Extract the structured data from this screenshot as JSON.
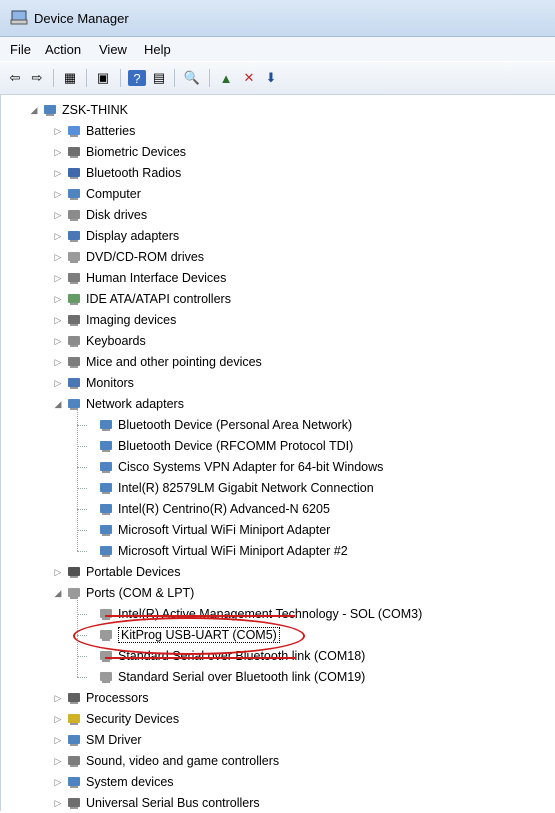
{
  "window": {
    "title": "Device Manager"
  },
  "menu": [
    "File",
    "Action",
    "View",
    "Help"
  ],
  "toolbar": [
    "back-icon",
    "forward-icon",
    "properties-icon",
    "show-hide-icon",
    "help-icon",
    "view-icon",
    "scan-icon",
    "update-driver-icon",
    "uninstall-icon",
    "disable-icon"
  ],
  "tree": {
    "root": "ZSK-THINK",
    "items": [
      {
        "label": "Batteries",
        "icon": "battery-icon",
        "color": "#3a7bd5"
      },
      {
        "label": "Biometric Devices",
        "icon": "fingerprint-icon",
        "color": "#555"
      },
      {
        "label": "Bluetooth Radios",
        "icon": "bluetooth-icon",
        "color": "#1e4f9c"
      },
      {
        "label": "Computer",
        "icon": "computer-icon",
        "color": "#2f6fb5"
      },
      {
        "label": "Disk drives",
        "icon": "disk-icon",
        "color": "#777"
      },
      {
        "label": "Display adapters",
        "icon": "display-icon",
        "color": "#2a5fa8"
      },
      {
        "label": "DVD/CD-ROM drives",
        "icon": "dvd-icon",
        "color": "#888"
      },
      {
        "label": "Human Interface Devices",
        "icon": "hid-icon",
        "color": "#666"
      },
      {
        "label": "IDE ATA/ATAPI controllers",
        "icon": "ide-icon",
        "color": "#4a8a4a"
      },
      {
        "label": "Imaging devices",
        "icon": "camera-icon",
        "color": "#555"
      },
      {
        "label": "Keyboards",
        "icon": "keyboard-icon",
        "color": "#777"
      },
      {
        "label": "Mice and other pointing devices",
        "icon": "mouse-icon",
        "color": "#666"
      },
      {
        "label": "Monitors",
        "icon": "monitor-icon",
        "color": "#2a5fa8"
      },
      {
        "label": "Network adapters",
        "icon": "network-icon",
        "color": "#2f6fb5",
        "expanded": true,
        "children": [
          "Bluetooth Device (Personal Area Network)",
          "Bluetooth Device (RFCOMM Protocol TDI)",
          "Cisco Systems VPN Adapter for 64-bit Windows",
          "Intel(R) 82579LM Gigabit Network Connection",
          "Intel(R) Centrino(R) Advanced-N 6205",
          "Microsoft Virtual WiFi Miniport Adapter",
          "Microsoft Virtual WiFi Miniport Adapter #2"
        ]
      },
      {
        "label": "Portable Devices",
        "icon": "portable-icon",
        "color": "#333"
      },
      {
        "label": "Ports (COM & LPT)",
        "icon": "port-icon",
        "color": "#888",
        "expanded": true,
        "children": [
          "Intel(R) Active Management Technology - SOL (COM3)",
          "KitProg USB-UART (COM5)",
          "Standard Serial over Bluetooth link (COM18)",
          "Standard Serial over Bluetooth link (COM19)"
        ]
      },
      {
        "label": "Processors",
        "icon": "processor-icon",
        "color": "#444"
      },
      {
        "label": "Security Devices",
        "icon": "security-icon",
        "color": "#c8a400"
      },
      {
        "label": "SM Driver",
        "icon": "driver-icon",
        "color": "#2f6fb5"
      },
      {
        "label": "Sound, video and game controllers",
        "icon": "sound-icon",
        "color": "#666"
      },
      {
        "label": "System devices",
        "icon": "system-icon",
        "color": "#2f6fb5"
      },
      {
        "label": "Universal Serial Bus controllers",
        "icon": "usb-icon",
        "color": "#555"
      }
    ]
  }
}
